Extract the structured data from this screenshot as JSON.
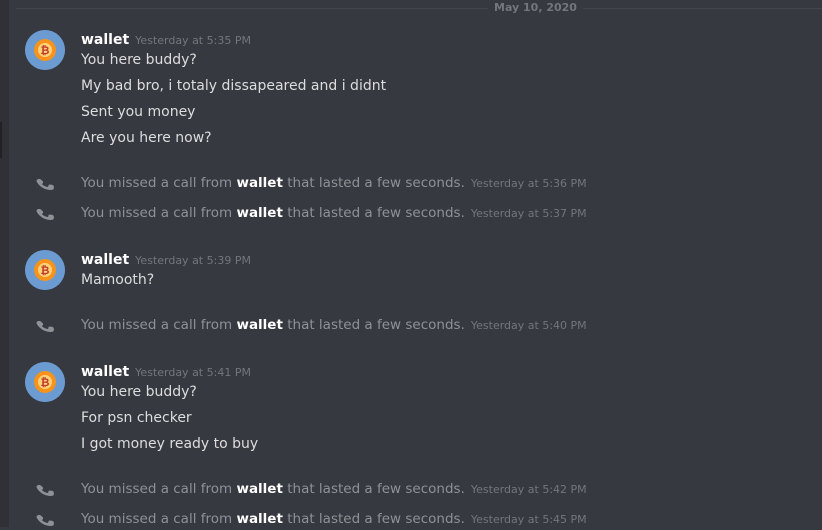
{
  "date_divider": "May 10, 2020",
  "groups": [
    {
      "username": "wallet",
      "timestamp": "Yesterday at 5:35 PM",
      "lines": [
        "You here buddy?",
        "My bad bro, i totaly dissapeared and i didnt",
        "Sent you money",
        "Are you here now?"
      ]
    },
    {
      "username": "wallet",
      "timestamp": "Yesterday at 5:39 PM",
      "lines": [
        "Mamooth?"
      ]
    },
    {
      "username": "wallet",
      "timestamp": "Yesterday at 5:41 PM",
      "lines": [
        "You here buddy?",
        "For psn checker",
        "I got money ready to buy"
      ]
    }
  ],
  "calls": [
    {
      "prefix": "You missed a call from ",
      "caller": "wallet",
      "suffix": " that lasted a few seconds.",
      "timestamp": "Yesterday at 5:36 PM"
    },
    {
      "prefix": "You missed a call from ",
      "caller": "wallet",
      "suffix": " that lasted a few seconds.",
      "timestamp": "Yesterday at 5:37 PM"
    },
    {
      "prefix": "You missed a call from ",
      "caller": "wallet",
      "suffix": " that lasted a few seconds.",
      "timestamp": "Yesterday at 5:40 PM"
    },
    {
      "prefix": "You missed a call from ",
      "caller": "wallet",
      "suffix": " that lasted a few seconds.",
      "timestamp": "Yesterday at 5:42 PM"
    },
    {
      "prefix": "You missed a call from ",
      "caller": "wallet",
      "suffix": " that lasted a few seconds.",
      "timestamp": "Yesterday at 5:45 PM"
    }
  ],
  "icons": {
    "avatar": "bitcoin-avatar-icon",
    "call": "phone-missed-icon"
  },
  "colors": {
    "background": "#36393f",
    "username": "#ffffff",
    "message": "#dcddde",
    "timestamp": "#72767d",
    "system_text": "#8e9297",
    "avatar_bg": "#6b9bd1",
    "avatar_coin": "#f7931a"
  }
}
